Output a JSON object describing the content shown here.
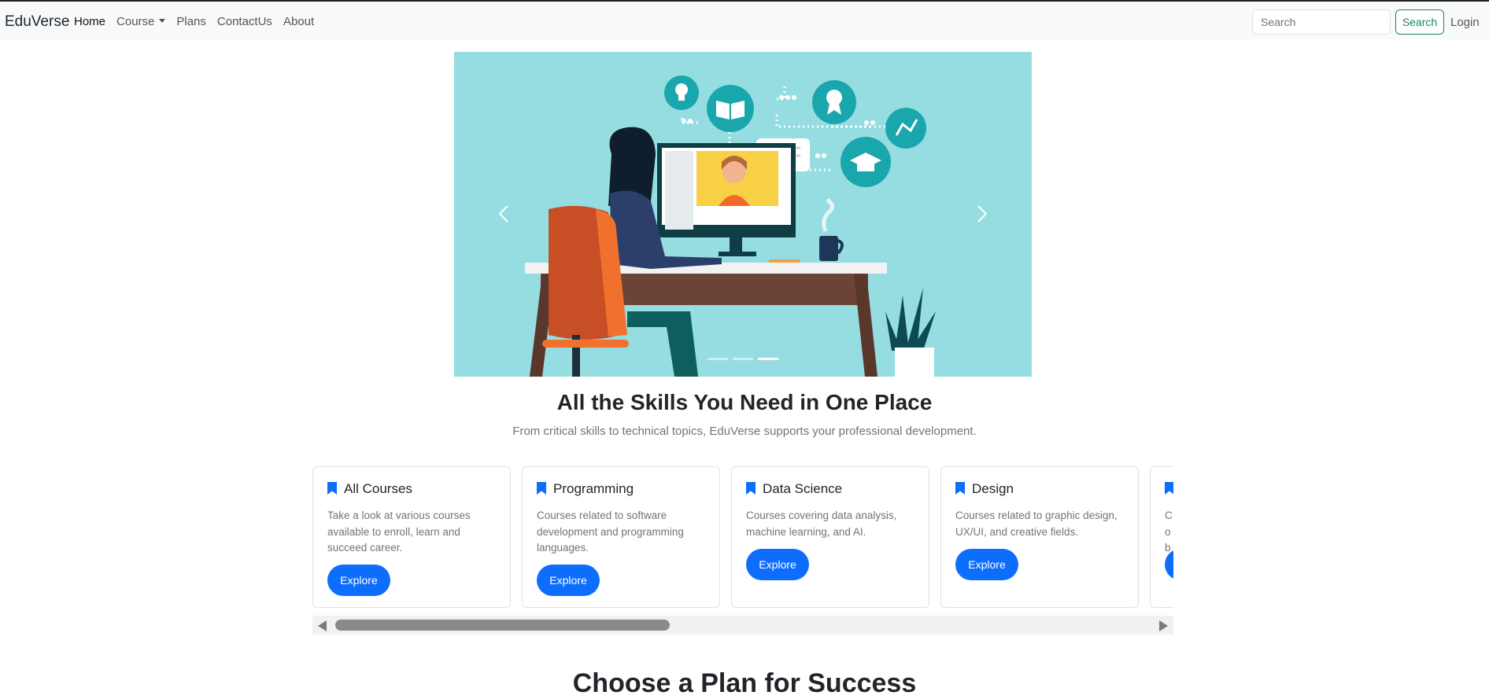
{
  "navbar": {
    "brand": "EduVerse",
    "links": [
      {
        "label": "Home",
        "active": true
      },
      {
        "label": "Course",
        "dropdown": true
      },
      {
        "label": "Plans"
      },
      {
        "label": "ContactUs"
      },
      {
        "label": "About"
      }
    ],
    "search_placeholder": "Search",
    "search_button": "Search",
    "login": "Login"
  },
  "carousel": {
    "slides": 3,
    "active_slide": 3,
    "prev_icon": "chevron-left-icon",
    "next_icon": "chevron-right-icon"
  },
  "hero": {
    "title": "All the Skills You Need in One Place",
    "subtitle": "From critical skills to technical topics, EduVerse supports your professional development."
  },
  "cards": [
    {
      "title": "All Courses",
      "text": "Take a look at various courses available to enroll, learn and succeed career.",
      "button": "Explore"
    },
    {
      "title": "Programming",
      "text": "Courses related to software development and programming languages.",
      "button": "Explore"
    },
    {
      "title": "Data Science",
      "text": "Courses covering data analysis, machine learning, and AI.",
      "button": "Explore"
    },
    {
      "title": "Design",
      "text": "Courses related to graphic design, UX/UI, and creative fields.",
      "button": "Explore"
    },
    {
      "title": "",
      "text": "Co ba",
      "button": ""
    }
  ],
  "plans": {
    "title": "Choose a Plan for Success"
  },
  "colors": {
    "primary": "#0d6efd",
    "success": "#198754",
    "carousel_bg": "#96dde2"
  }
}
